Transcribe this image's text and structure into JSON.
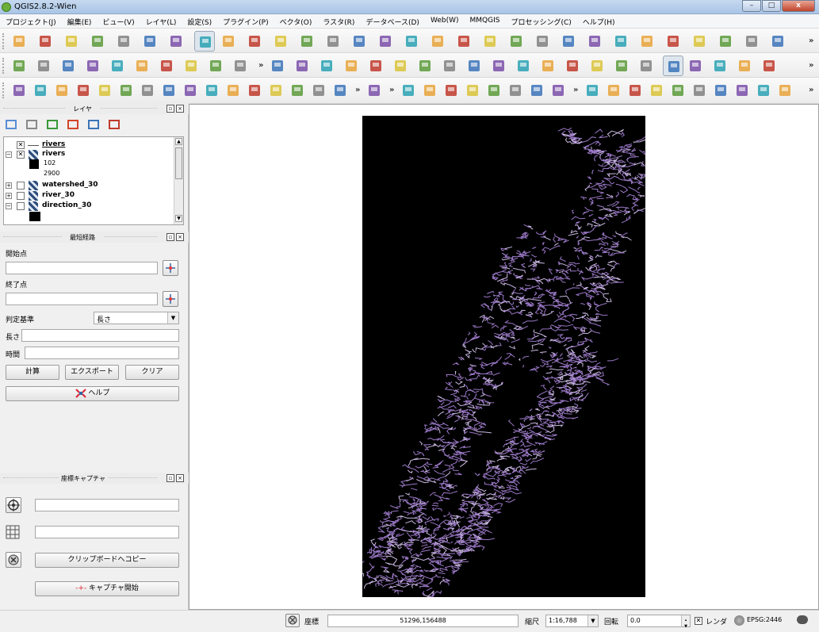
{
  "app": {
    "title": "QGIS2.8.2-Wien"
  },
  "window_controls": {
    "minimize": "–",
    "maximize": "□",
    "close": "x"
  },
  "menus": [
    "プロジェクト(J)",
    "編集(E)",
    "ビュー(V)",
    "レイヤ(L)",
    "設定(S)",
    "プラグイン(P)",
    "ベクタ(O)",
    "ラスタ(R)",
    "データベース(D)",
    "Web(W)",
    "MMQGIS",
    "プロセッシング(C)",
    "ヘルプ(H)"
  ],
  "toolbars": {
    "more": "»",
    "row1": [
      "new-project-icon",
      "open-project-icon",
      "save-project-icon",
      "save-as-icon",
      "new-print-composer-icon",
      "composer-manager-icon",
      "touch-zoom-icon",
      "pan-icon",
      "pan-to-selection-icon",
      "zoom-in-icon",
      "zoom-out-icon",
      "zoom-actual-size-icon",
      "zoom-full-icon",
      "zoom-to-selection-icon",
      "zoom-to-layer-icon",
      "zoom-last-icon",
      "zoom-next-icon",
      "refresh-icon",
      "identify-icon",
      "run-feature-action-icon",
      "select-features-icon",
      "deselect-icon",
      "expression-select-icon",
      "attribute-table-icon",
      "field-calculator-icon",
      "measure-icon",
      "annotation-icon",
      "add-annotation-icon",
      "svg-annotation-icon",
      "text-annotation-icon"
    ],
    "row2": [
      "current-edits-icon",
      "toggle-editing-icon",
      "save-edits-icon",
      "add-feature-icon",
      "move-feature-icon",
      "node-tool-icon",
      "delete-selected-icon",
      "cut-features-icon",
      "copy-features-icon",
      "paste-features-icon",
      "label-toolbar-icon",
      "pin-labels-icon",
      "highlight-pinned-icon",
      "move-label-icon",
      "rotate-label-icon",
      "change-label-icon",
      "csv-icon",
      "qgis-cloud-icon",
      "geo-icon",
      "python-console-icon",
      "vector-network-icon",
      "binoculars-icon",
      "terrain-icon",
      "info-search-icon",
      "help-icon",
      "whats-this-icon",
      "coordinate-capture-icon",
      "georeferencer-icon",
      "globe-icon",
      "grass-icon",
      "openlayers-icon"
    ],
    "row3": [
      "ruler-icon",
      "undo-icon",
      "redo-icon",
      "simplify-icon",
      "add-ring-icon",
      "add-part-icon",
      "fill-ring-icon",
      "delete-ring-icon",
      "delete-part-icon",
      "reshape-icon",
      "offset-curve-icon",
      "split-features-icon",
      "split-parts-icon",
      "merge-features-icon",
      "merge-attributes-icon",
      "rotate-point-icon",
      "capture-icon",
      "add-vector-layer-icon",
      "add-raster-layer-icon",
      "add-postgis-icon",
      "add-spatialite-icon",
      "add-mssql-icon",
      "add-oracle-icon",
      "add-wms-icon",
      "add-wcs-icon",
      "add-wfs-icon",
      "add-delimited-text-icon",
      "new-shapefile-icon",
      "new-spatialite-icon",
      "new-temp-layer-icon",
      "raster-calculator-icon",
      "raster-stretch-icon",
      "histogram-icon",
      "raster-info-icon",
      "georef-icon"
    ]
  },
  "layers_panel": {
    "title": "レイヤ",
    "tools": [
      "add-group-icon",
      "manage-visibility-icon",
      "filter-legend-icon",
      "expand-all-icon",
      "collapse-all-icon",
      "remove-layer-icon"
    ],
    "items": [
      {
        "name": "rivers",
        "checked": true,
        "expanded": false,
        "kind": "vector-line"
      },
      {
        "name": "rivers",
        "checked": true,
        "expanded": true,
        "kind": "raster"
      },
      {
        "name": "watershed_30",
        "checked": false,
        "expanded": false,
        "kind": "raster"
      },
      {
        "name": "river_30",
        "checked": false,
        "expanded": false,
        "kind": "raster"
      },
      {
        "name": "direction_30",
        "checked": false,
        "expanded": true,
        "kind": "raster"
      }
    ],
    "legend_values": [
      "102",
      "2900"
    ]
  },
  "route_panel": {
    "title": "最短経路",
    "start_label": "開始点",
    "start_value": "",
    "end_label": "終了点",
    "end_value": "",
    "criterion_label": "判定基準",
    "criterion_value": "長さ",
    "length_label": "長さ",
    "length_value": "",
    "time_label": "時間",
    "time_value": "",
    "calc_button": "計算",
    "export_button": "エクスポート",
    "clear_button": "クリア",
    "help_button": "ヘルプ"
  },
  "coord_panel": {
    "title": "座標キャプチャ",
    "field1_value": "",
    "field2_value": "",
    "copy_button": "クリップボードへコピー",
    "capture_button": "キャプチャ開始"
  },
  "status": {
    "coord_label": "座標",
    "coord_value": "51296,156488",
    "scale_label": "縮尺",
    "scale_value": "1:16,788",
    "rotation_label": "回転",
    "rotation_value": "0.0",
    "render_label": "レンダ",
    "render_checked": true,
    "crs": "EPSG:2446"
  },
  "colors": {
    "river_line": "#9a78c6",
    "river_line_light": "#c9b8e0",
    "raster_bg": "#000000",
    "title_bar": "#bcd3ed"
  }
}
